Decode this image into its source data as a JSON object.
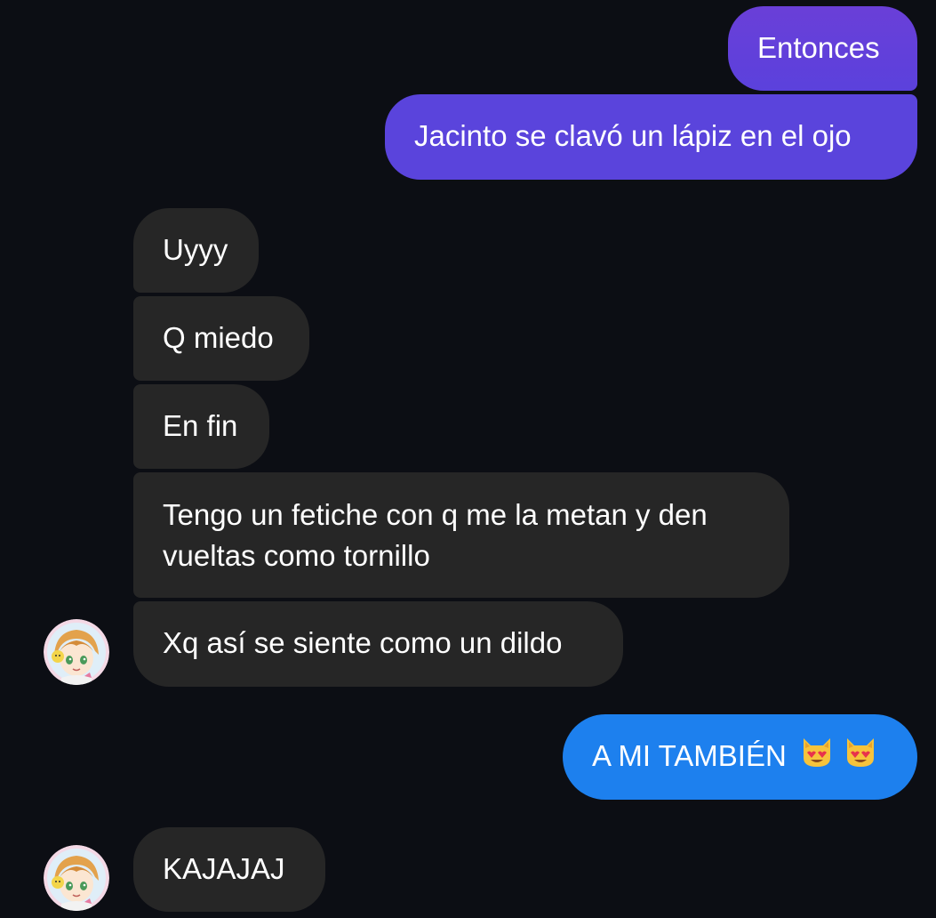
{
  "conversation": {
    "messages": [
      {
        "text": "Entonces",
        "direction": "sent",
        "avatar": false
      },
      {
        "text": "Jacinto se clavó un lápiz en el ojo",
        "direction": "sent",
        "avatar": false
      },
      {
        "text": "Uyyy",
        "direction": "received",
        "avatar": false
      },
      {
        "text": "Q miedo",
        "direction": "received",
        "avatar": false
      },
      {
        "text": "En fin",
        "direction": "received",
        "avatar": false
      },
      {
        "text": "Tengo un fetiche con q me la metan y den vueltas como tornillo",
        "direction": "received",
        "avatar": false
      },
      {
        "text": "Xq así se siente como un dildo",
        "direction": "received",
        "avatar": true
      },
      {
        "text": "A MI TAMBIÉN",
        "direction": "sent",
        "avatar": false,
        "emoji": [
          "smiling-cat-heart-eyes-icon",
          "smiling-cat-heart-eyes-icon"
        ]
      },
      {
        "text": "KAJAJAJ",
        "direction": "received",
        "avatar": true
      }
    ]
  },
  "colors": {
    "background": "#0c0e14",
    "sent_purple": "#5a44dc",
    "sent_blue": "#1d80ee",
    "received": "#262626",
    "text": "#ffffff"
  }
}
